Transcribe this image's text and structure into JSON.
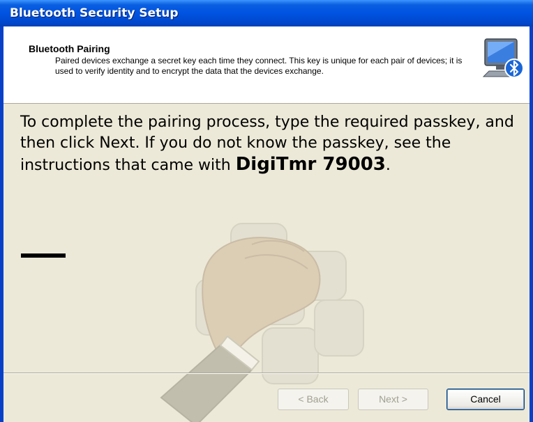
{
  "window": {
    "title": "Bluetooth Security Setup"
  },
  "header": {
    "title": "Bluetooth Pairing",
    "description": "Paired devices exchange a secret key each time they connect. This key is unique for each pair of devices; it is used to verify identity and to encrypt the data that the devices exchange.",
    "icon": "computer-bluetooth-icon"
  },
  "main": {
    "instruction_prefix": "To complete the pairing process, type the required passkey, and then click Next. If you do not know the passkey, see the instructions that came with ",
    "device_name": "DigiTmr 79003",
    "instruction_suffix": ".",
    "passkey_value": "",
    "watermark_icon": "hand-keypad-icon"
  },
  "buttons": {
    "back": "< Back",
    "next": "Next >",
    "cancel": "Cancel"
  },
  "colors": {
    "titlebar": "#0053e1",
    "dialog_bg": "#ece9d8",
    "header_bg": "#ffffff"
  }
}
